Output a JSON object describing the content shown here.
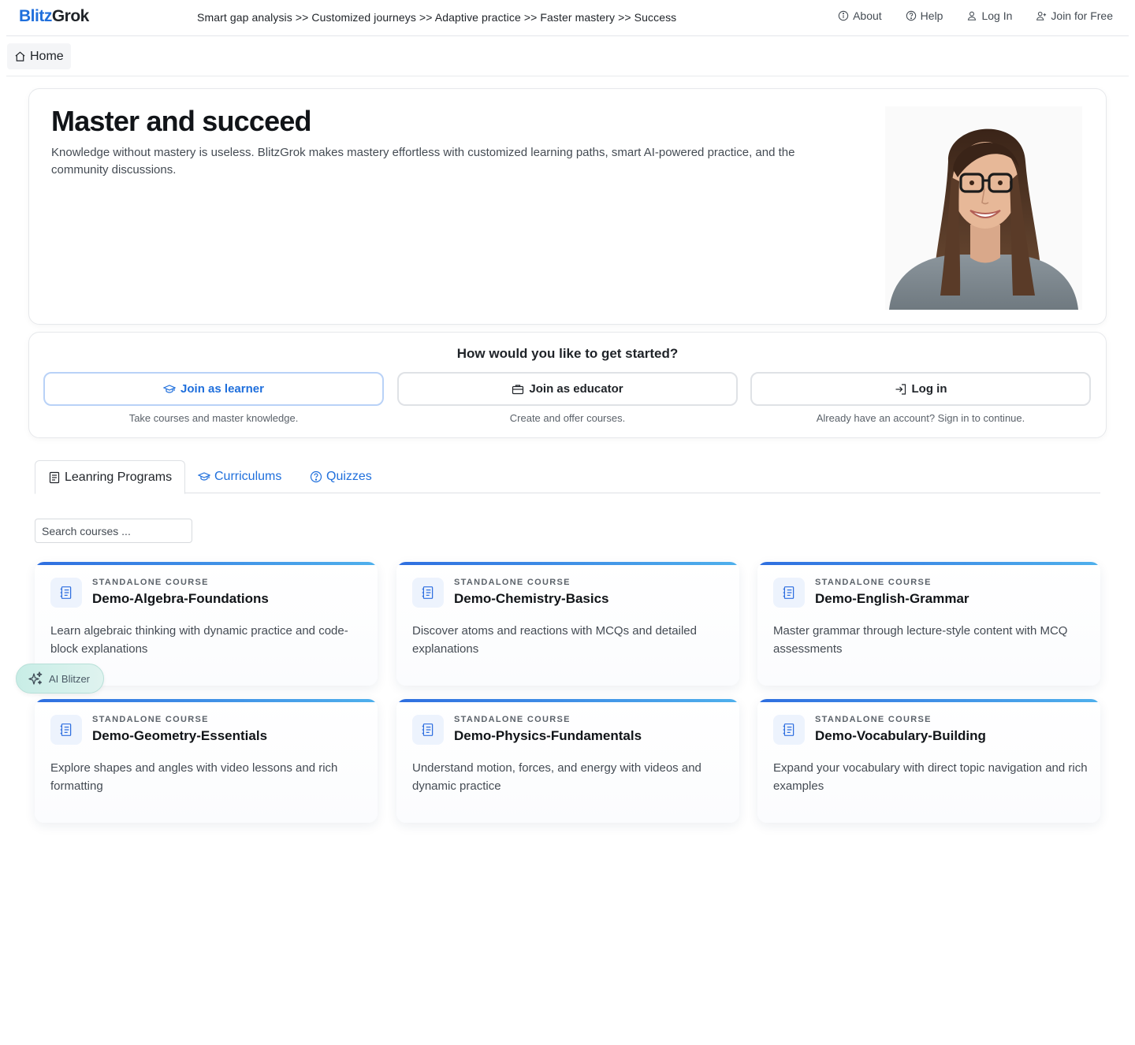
{
  "brand": {
    "part1": "Blitz",
    "part2": "Grok"
  },
  "header": {
    "tagline": "Smart gap analysis >> Customized journeys >> Adaptive practice >> Faster mastery >> Success",
    "nav": {
      "about": "About",
      "help": "Help",
      "login": "Log In",
      "join": "Join for Free"
    }
  },
  "breadcrumb": {
    "home": "Home"
  },
  "hero": {
    "title": "Master and succeed",
    "description": "Knowledge without mastery is useless. BlitzGrok makes mastery effortless with customized learning paths, smart AI-powered practice, and the community discussions."
  },
  "get_started": {
    "title": "How would you like to get started?",
    "options": [
      {
        "label": "Join as learner",
        "subtitle": "Take courses and master knowledge.",
        "icon": "graduation-cap-icon"
      },
      {
        "label": "Join as educator",
        "subtitle": "Create and offer courses.",
        "icon": "briefcase-icon"
      },
      {
        "label": "Log in",
        "subtitle": "Already have an account? Sign in to continue.",
        "icon": "login-icon"
      }
    ]
  },
  "tabs": {
    "programs": "Leanring Programs",
    "curriculums": "Curriculums",
    "quizzes": "Quizzes"
  },
  "search": {
    "placeholder": "Search courses ..."
  },
  "courses": [
    {
      "kind": "STANDALONE COURSE",
      "title": "Demo-Algebra-Foundations",
      "description": "Learn algebraic thinking with dynamic practice and code-block explanations"
    },
    {
      "kind": "STANDALONE COURSE",
      "title": "Demo-Chemistry-Basics",
      "description": "Discover atoms and reactions with MCQs and detailed explanations"
    },
    {
      "kind": "STANDALONE COURSE",
      "title": "Demo-English-Grammar",
      "description": "Master grammar through lecture-style content with MCQ assessments"
    },
    {
      "kind": "STANDALONE COURSE",
      "title": "Demo-Geometry-Essentials",
      "description": "Explore shapes and angles with video lessons and rich formatting"
    },
    {
      "kind": "STANDALONE COURSE",
      "title": "Demo-Physics-Fundamentals",
      "description": "Understand motion, forces, and energy with videos and dynamic practice"
    },
    {
      "kind": "STANDALONE COURSE",
      "title": "Demo-Vocabulary-Building",
      "description": "Expand your vocabulary with direct topic navigation and rich examples"
    }
  ],
  "ai_assistant": {
    "label": "AI Blitzer"
  },
  "colors": {
    "accent": "#1f6fdc",
    "card_bar_start": "#2f6fe0",
    "card_bar_end": "#4fb0ec",
    "ai_button_bg": "#c8ede6"
  }
}
